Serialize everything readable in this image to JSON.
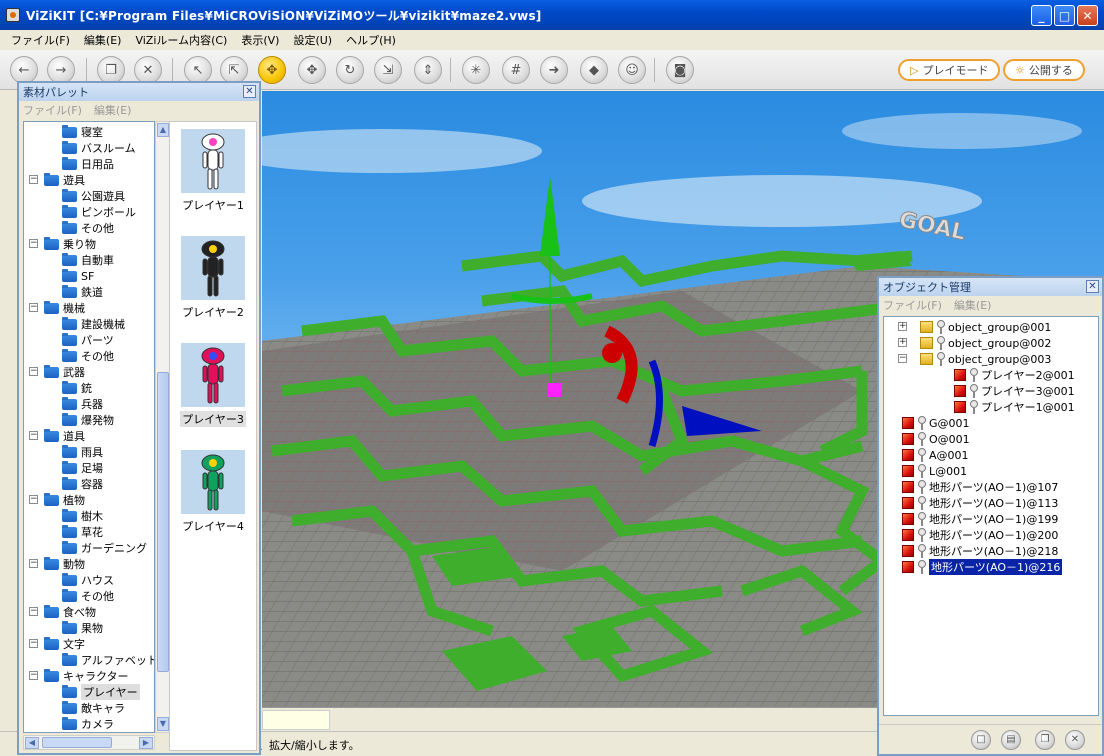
{
  "window": {
    "title": "ViZiKIT [C:¥Program Files¥MiCROViSiON¥ViZiMOツール¥vizikit¥maze2.vws]",
    "minimize": "_",
    "maximize": "□",
    "close": "✕"
  },
  "menu": [
    "ファイル(F)",
    "編集(E)",
    "ViZiルーム内容(C)",
    "表示(V)",
    "設定(U)",
    "ヘルプ(H)"
  ],
  "toolbar": {
    "buttons": [
      {
        "name": "back-button",
        "glyph": "←",
        "active": false
      },
      {
        "name": "forward-button",
        "glyph": "→",
        "active": false
      },
      {
        "name": "copy-button",
        "glyph": "❐",
        "active": false
      },
      {
        "name": "delete-button",
        "glyph": "✕",
        "active": false
      },
      {
        "name": "select-button",
        "glyph": "↖",
        "active": false
      },
      {
        "name": "select-multi-button",
        "glyph": "⇱",
        "active": false
      },
      {
        "name": "snap-button",
        "glyph": "✥",
        "active": true
      },
      {
        "name": "move-button",
        "glyph": "✥",
        "active": false
      },
      {
        "name": "rotate-button",
        "glyph": "↻",
        "active": false
      },
      {
        "name": "scale-button",
        "glyph": "⇲",
        "active": false
      },
      {
        "name": "resize-button",
        "glyph": "⇕",
        "active": false
      },
      {
        "name": "axis-button",
        "glyph": "✳",
        "active": false
      },
      {
        "name": "grid-on-button",
        "glyph": "#",
        "active": false
      },
      {
        "name": "arrow-off-button",
        "glyph": "➜",
        "active": false
      },
      {
        "name": "cube-off-button",
        "glyph": "◆",
        "active": false
      },
      {
        "name": "character-button",
        "glyph": "☺",
        "active": false
      },
      {
        "name": "screenshot-button",
        "glyph": "◙",
        "active": false
      }
    ],
    "play_mode": "プレイモード",
    "publish": "公開する",
    "play_glyph": "▷",
    "publish_glyph": "☼"
  },
  "palette": {
    "title": "素材パレット",
    "menu_file": "ファイル(F)",
    "menu_edit": "編集(E)",
    "tree": [
      {
        "label": "寝室",
        "level": 1
      },
      {
        "label": "バスルーム",
        "level": 1
      },
      {
        "label": "日用品",
        "level": 1
      },
      {
        "label": "遊具",
        "level": 0
      },
      {
        "label": "公園遊具",
        "level": 1
      },
      {
        "label": "ピンボール",
        "level": 1
      },
      {
        "label": "その他",
        "level": 1
      },
      {
        "label": "乗り物",
        "level": 0
      },
      {
        "label": "自動車",
        "level": 1
      },
      {
        "label": "SF",
        "level": 1
      },
      {
        "label": "鉄道",
        "level": 1
      },
      {
        "label": "機械",
        "level": 0
      },
      {
        "label": "建設機械",
        "level": 1
      },
      {
        "label": "パーツ",
        "level": 1
      },
      {
        "label": "その他",
        "level": 1
      },
      {
        "label": "武器",
        "level": 0
      },
      {
        "label": "銃",
        "level": 1
      },
      {
        "label": "兵器",
        "level": 1
      },
      {
        "label": "爆発物",
        "level": 1
      },
      {
        "label": "道具",
        "level": 0
      },
      {
        "label": "雨具",
        "level": 1
      },
      {
        "label": "足場",
        "level": 1
      },
      {
        "label": "容器",
        "level": 1
      },
      {
        "label": "植物",
        "level": 0
      },
      {
        "label": "樹木",
        "level": 1
      },
      {
        "label": "草花",
        "level": 1
      },
      {
        "label": "ガーデニング",
        "level": 1
      },
      {
        "label": "動物",
        "level": 0
      },
      {
        "label": "ハウス",
        "level": 1
      },
      {
        "label": "その他",
        "level": 1
      },
      {
        "label": "食べ物",
        "level": 0
      },
      {
        "label": "果物",
        "level": 1
      },
      {
        "label": "文字",
        "level": 0
      },
      {
        "label": "アルファベット",
        "level": 1
      },
      {
        "label": "キャラクター",
        "level": 0
      },
      {
        "label": "プレイヤー",
        "level": 1,
        "selected": true
      },
      {
        "label": "敵キャラ",
        "level": 1
      },
      {
        "label": "カメラ",
        "level": 1
      }
    ],
    "items": [
      {
        "label": "プレイヤー1",
        "color": "#ffffff",
        "head": "#ff40c0"
      },
      {
        "label": "プレイヤー2",
        "color": "#222222",
        "head": "#ffd000"
      },
      {
        "label": "プレイヤー3",
        "color": "#e0105a",
        "head": "#3050ff",
        "selected": true
      },
      {
        "label": "プレイヤー4",
        "color": "#10a060",
        "head": "#ffd000"
      }
    ]
  },
  "viewport": {
    "goal_text": "GOAL"
  },
  "objmgr": {
    "title": "オブジェクト管理",
    "menu_file": "ファイル(F)",
    "menu_edit": "編集(E)",
    "rows": [
      {
        "label": "object_group@001",
        "type": "group",
        "level": 0,
        "expander": "+"
      },
      {
        "label": "object_group@002",
        "type": "group",
        "level": 0,
        "expander": "+"
      },
      {
        "label": "object_group@003",
        "type": "group",
        "level": 0,
        "expander": "−"
      },
      {
        "label": "プレイヤー2@001",
        "type": "cube",
        "level": 1
      },
      {
        "label": "プレイヤー3@001",
        "type": "cube",
        "level": 1
      },
      {
        "label": "プレイヤー1@001",
        "type": "cube",
        "level": 1
      },
      {
        "label": "G@001",
        "type": "cube",
        "level": 0
      },
      {
        "label": "O@001",
        "type": "cube",
        "level": 0
      },
      {
        "label": "A@001",
        "type": "cube",
        "level": 0
      },
      {
        "label": "L@001",
        "type": "cube",
        "level": 0
      },
      {
        "label": "地形パーツ(AO－1)@107",
        "type": "cube",
        "level": 0
      },
      {
        "label": "地形パーツ(AO－1)@113",
        "type": "cube",
        "level": 0
      },
      {
        "label": "地形パーツ(AO－1)@199",
        "type": "cube",
        "level": 0
      },
      {
        "label": "地形パーツ(AO－1)@200",
        "type": "cube",
        "level": 0
      },
      {
        "label": "地形パーツ(AO－1)@218",
        "type": "cube",
        "level": 0
      },
      {
        "label": "地形パーツ(AO－1)@216",
        "type": "cube",
        "level": 0,
        "selected": true
      }
    ],
    "footer_buttons": [
      "□",
      "▤",
      "❐",
      "✕"
    ]
  },
  "status": {
    "message": "、拡大/縮小します。"
  }
}
